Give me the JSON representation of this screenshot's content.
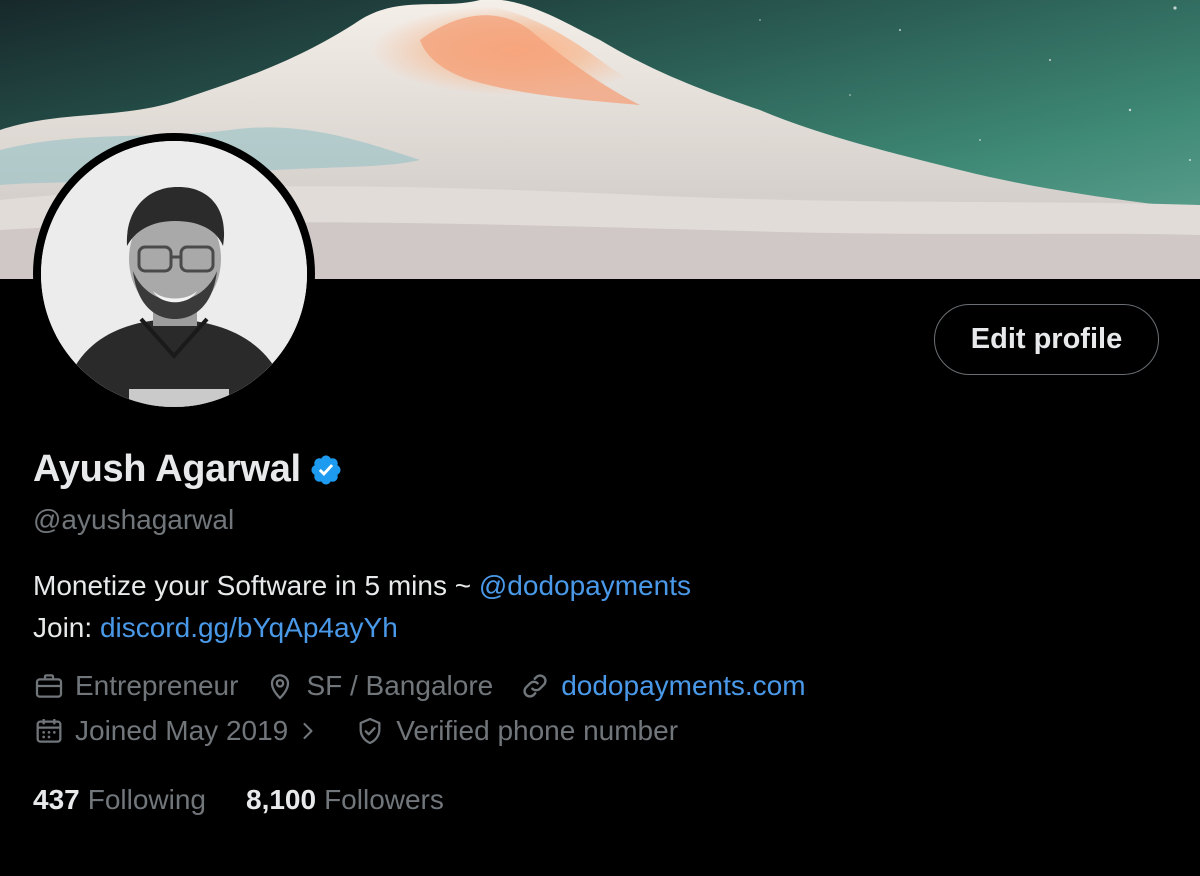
{
  "profile": {
    "name": "Ayush Agarwal",
    "handle": "@ayushagarwal",
    "edit_profile_label": "Edit profile",
    "verified": true
  },
  "bio": {
    "line1_text": "Monetize your Software in 5 mins ~ ",
    "line1_mention": "@dodopayments",
    "line2_text": "Join: ",
    "line2_link": "discord.gg/bYqAp4ayYh"
  },
  "meta": {
    "profession": "Entrepreneur",
    "location": "SF / Bangalore",
    "website": "dodopayments.com",
    "joined": "Joined May 2019",
    "verified_phone": "Verified phone number"
  },
  "stats": {
    "following_count": "437",
    "following_label": "Following",
    "followers_count": "8,100",
    "followers_label": "Followers"
  },
  "icons": {
    "verified": "verified-badge-icon",
    "profession": "briefcase-icon",
    "location": "location-pin-icon",
    "website": "link-icon",
    "joined": "calendar-icon",
    "joined_chevron": "chevron-right-icon",
    "verified_phone": "shield-check-icon"
  },
  "colors": {
    "background": "#000000",
    "text_primary": "#e7e9ea",
    "text_secondary": "#71767b",
    "accent_link": "#4a99e9",
    "verified_badge": "#1d9bf0"
  }
}
